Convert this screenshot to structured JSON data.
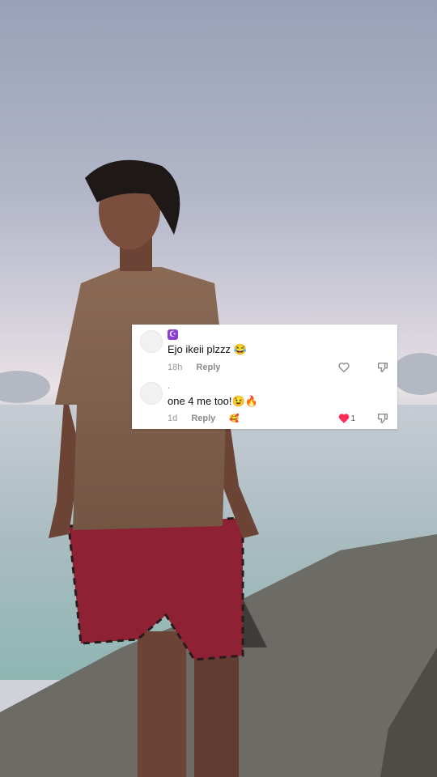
{
  "comments": [
    {
      "username_badge": "☪",
      "text": "Ejo ikeii plzzz 😂",
      "age": "18h",
      "reply_label": "Reply",
      "liked": false,
      "like_count": ""
    },
    {
      "username_badge": ".",
      "text": "one 4 me too!😉🔥",
      "age": "1d",
      "reply_label": "Reply",
      "creator_liked_icon": "🥰",
      "liked": true,
      "like_count": "1"
    }
  ],
  "colors": {
    "like_active": "#fe2c55",
    "icon_gray": "#8a8a8a"
  }
}
